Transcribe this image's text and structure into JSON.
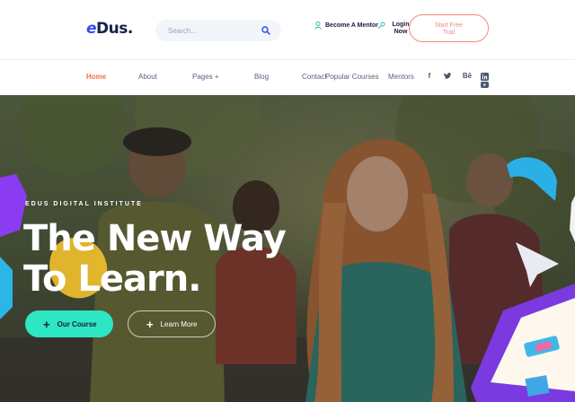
{
  "brand": {
    "logo_e": "e",
    "logo_rest": "Dus."
  },
  "search": {
    "placeholder": "Search...",
    "icon": "search-icon"
  },
  "header": {
    "become_mentor": "Become A Mentor",
    "login_line1": "Login",
    "login_line2": "Now",
    "trial_line1": "Start Free",
    "trial_line2": "Trail"
  },
  "nav": {
    "home": "Home",
    "about": "About",
    "pages": "Pages +",
    "blog": "Blog",
    "contact": "Contact",
    "popular_courses": "Popular Courses",
    "mentors": "Mentors"
  },
  "social": {
    "facebook": "f",
    "behance": "Bē"
  },
  "hero": {
    "kicker": "EDUS DIGITAL INSTITUTE",
    "headline_line1": "The New Way",
    "headline_line2": "To Learn.",
    "primary_button": "Our Course",
    "secondary_button": "Learn More",
    "button_icon": "+"
  },
  "colors": {
    "accent_orange": "#e9783a",
    "cta_teal": "#2ee6c3",
    "trial_coral": "#f08a7e",
    "brand_blue": "#2f4ef0"
  }
}
